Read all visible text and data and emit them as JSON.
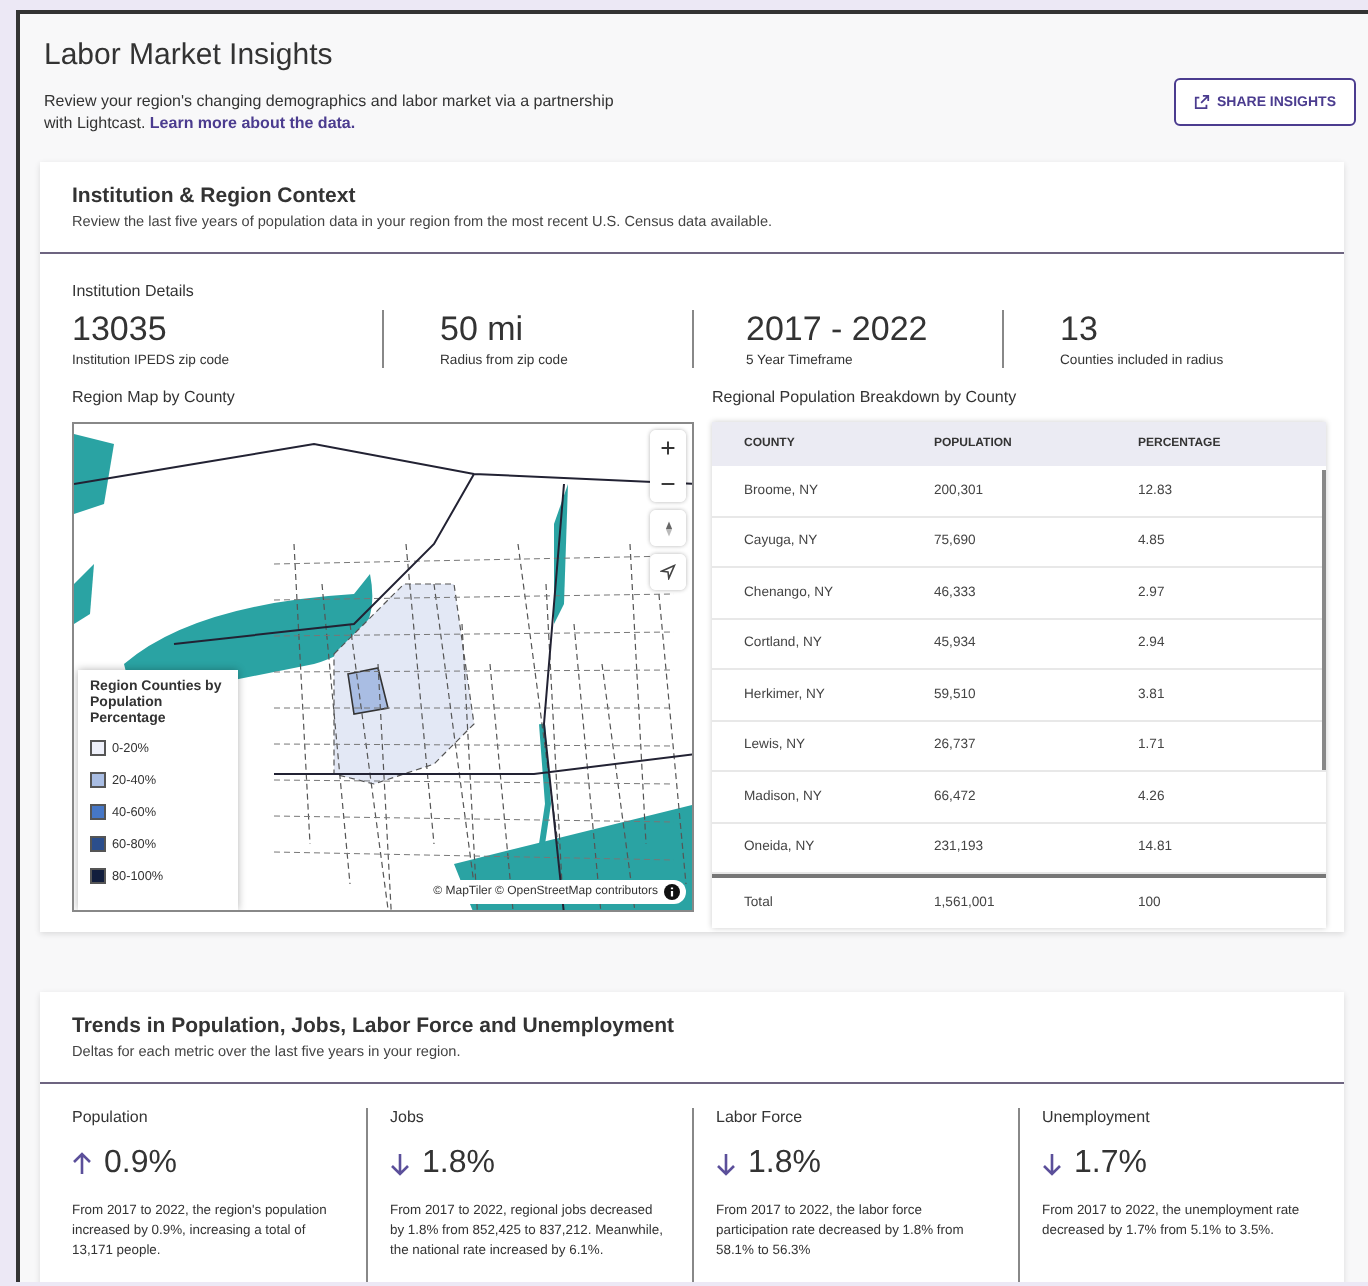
{
  "header": {
    "title": "Labor Market Insights",
    "description": "Review your region's changing demographics and labor market via a partnership with Lightcast. ",
    "link": "Learn more about the data.",
    "share_button": "SHARE INSIGHTS"
  },
  "context": {
    "title": "Institution & Region Context",
    "subtitle": "Review the last five years of population data in your region from the most recent U.S. Census data available.",
    "details_label": "Institution Details",
    "stats": [
      {
        "value": "13035",
        "label": "Institution IPEDS zip code"
      },
      {
        "value": "50 mi",
        "label": "Radius from zip code"
      },
      {
        "value": "2017 - 2022",
        "label": "5 Year Timeframe"
      },
      {
        "value": "13",
        "label": "Counties included in radius"
      }
    ],
    "map": {
      "title": "Region Map by County",
      "legend_title": "Region Counties by Population Percentage",
      "attribution": "© MapTiler © OpenStreetMap contributors",
      "legend": [
        {
          "label": "0-20%",
          "color": "#eef0fa"
        },
        {
          "label": "20-40%",
          "color": "#a9bde3"
        },
        {
          "label": "40-60%",
          "color": "#4677c6"
        },
        {
          "label": "60-80%",
          "color": "#2b4e8c"
        },
        {
          "label": "80-100%",
          "color": "#121e3d"
        }
      ]
    },
    "table": {
      "title": "Regional Population Breakdown by County",
      "columns": [
        "COUNTY",
        "POPULATION",
        "PERCENTAGE"
      ],
      "rows": [
        [
          "Broome, NY",
          "200,301",
          "12.83"
        ],
        [
          "Cayuga, NY",
          "75,690",
          "4.85"
        ],
        [
          "Chenango, NY",
          "46,333",
          "2.97"
        ],
        [
          "Cortland, NY",
          "45,934",
          "2.94"
        ],
        [
          "Herkimer, NY",
          "59,510",
          "3.81"
        ],
        [
          "Lewis, NY",
          "26,737",
          "1.71"
        ],
        [
          "Madison, NY",
          "66,472",
          "4.26"
        ],
        [
          "Oneida, NY",
          "231,193",
          "14.81"
        ]
      ],
      "total": [
        "Total",
        "1,561,001",
        "100"
      ]
    }
  },
  "trends": {
    "title": "Trends in Population, Jobs, Labor Force and Unemployment",
    "subtitle": "Deltas for each metric over the last five years in your region.",
    "metrics": [
      {
        "name": "Population",
        "kind": "increase",
        "value": "0.9%",
        "text": "From 2017 to 2022, the region's population increased by 0.9%, increasing a total of 13,171 people."
      },
      {
        "name": "Jobs",
        "kind": "decrease",
        "value": "1.8%",
        "text": "From 2017 to 2022, regional jobs decreased by 1.8% from 852,425 to 837,212. Meanwhile, the national rate increased by 6.1%."
      },
      {
        "name": "Labor Force",
        "kind": "decrease",
        "value": "1.8%",
        "text": "From 2017 to 2022, the labor force participation rate decreased by 1.8% from 58.1% to 56.3%"
      },
      {
        "name": "Unemployment",
        "kind": "decrease",
        "value": "1.7%",
        "text": "From 2017 to 2022, the unemployment rate decreased by 1.7% from 5.1% to 3.5%."
      }
    ]
  }
}
